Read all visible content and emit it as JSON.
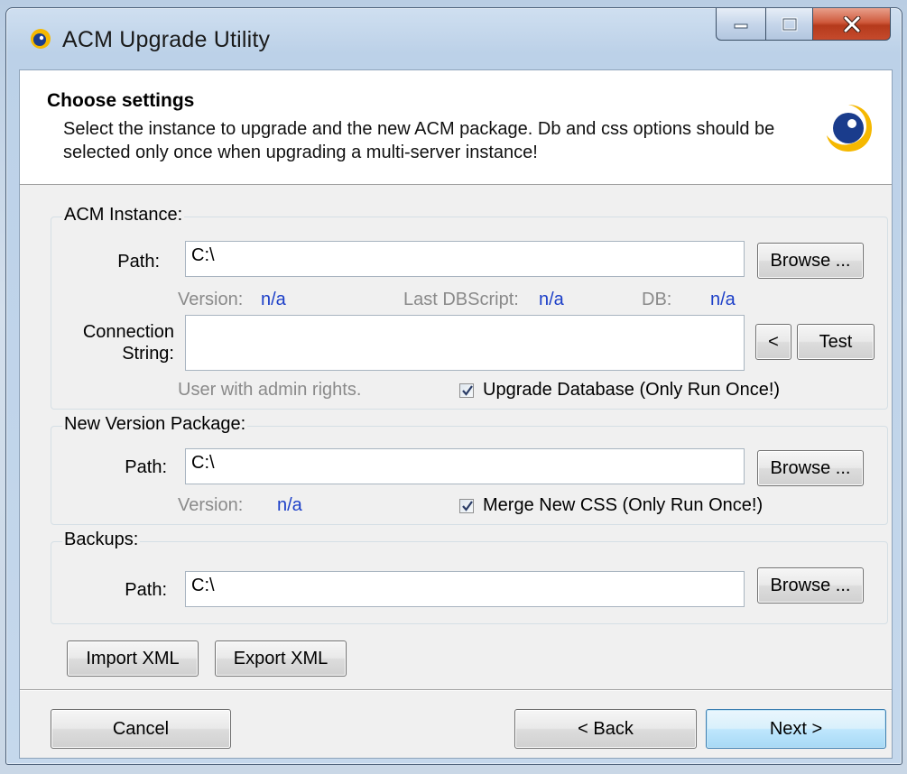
{
  "window": {
    "title": "ACM Upgrade Utility"
  },
  "header": {
    "title": "Choose settings",
    "description": "Select the instance to upgrade and the new ACM package. Db and css options should be selected only once when upgrading a multi-server instance!"
  },
  "acm_instance": {
    "group_label": "ACM Instance:",
    "path_label": "Path:",
    "path_value": "C:\\",
    "browse_label": "Browse ...",
    "version_label": "Version:",
    "version_value": "n/a",
    "last_dbscript_label": "Last DBScript:",
    "last_dbscript_value": "n/a",
    "db_label": "DB:",
    "db_value": "n/a",
    "connection_label_line1": "Connection",
    "connection_label_line2": "String:",
    "connection_value": "",
    "back_arrow_label": "<",
    "test_label": "Test",
    "hint": "User with admin rights.",
    "upgrade_db_label": "Upgrade Database (Only Run Once!)",
    "upgrade_db_checked": true
  },
  "new_version": {
    "group_label": "New Version Package:",
    "path_label": "Path:",
    "path_value": "C:\\",
    "browse_label": "Browse ...",
    "version_label": "Version:",
    "version_value": "n/a",
    "merge_css_label": "Merge New CSS (Only Run Once!)",
    "merge_css_checked": true
  },
  "backups": {
    "group_label": "Backups:",
    "path_label": "Path:",
    "path_value": "C:\\",
    "browse_label": "Browse ..."
  },
  "xml": {
    "import_label": "Import XML",
    "export_label": "Export XML"
  },
  "footer": {
    "cancel_label": "Cancel",
    "back_label": "< Back",
    "next_label": "Next >"
  },
  "colors": {
    "value_blue": "#1c3fc8",
    "label_gray": "#8a8a8a",
    "logo_yellow": "#f5b800",
    "logo_blue": "#1a3c8c"
  },
  "icons": {
    "app": "acm-logo-icon",
    "minimize": "minimize-icon",
    "maximize": "maximize-icon",
    "close": "close-icon",
    "header_logo": "acm-logo-icon",
    "checkmark": "checkmark-icon"
  }
}
